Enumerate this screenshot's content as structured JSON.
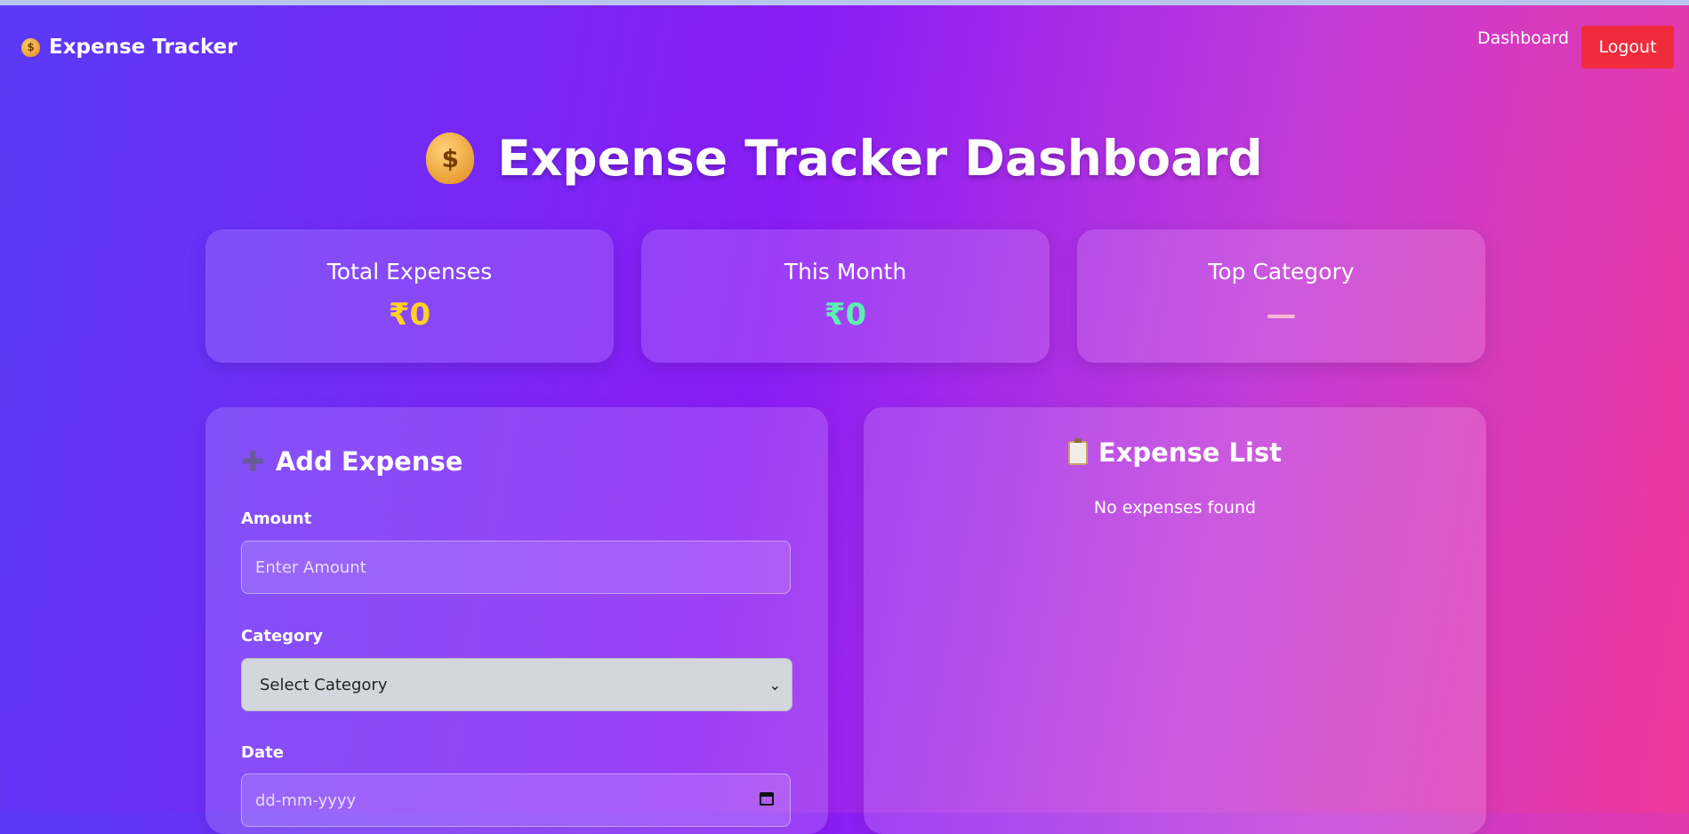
{
  "navbar": {
    "brand": "Expense Tracker",
    "brand_icon": "money-bag-icon",
    "dashboard_link": "Dashboard",
    "logout_label": "Logout"
  },
  "page": {
    "title": "Expense Tracker Dashboard",
    "title_icon": "money-bag-icon"
  },
  "summary": {
    "total": {
      "label": "Total Expenses",
      "value": "₹0",
      "color": "#ffd21f"
    },
    "month": {
      "label": "This Month",
      "value": "₹0",
      "color": "#5cf0b0"
    },
    "top": {
      "label": "Top Category",
      "value": "—",
      "color": "#ffb6d5"
    }
  },
  "add_form": {
    "title": "Add Expense",
    "title_icon": "plus-icon",
    "amount_label": "Amount",
    "amount_placeholder": "Enter Amount",
    "category_label": "Category",
    "category_selected": "Select Category",
    "date_label": "Date",
    "date_placeholder": "dd-mm-yyyy"
  },
  "expense_list": {
    "title": "Expense List",
    "title_icon": "clipboard-icon",
    "empty_text": "No expenses found"
  },
  "colors": {
    "logout_bg": "#f02b3b"
  }
}
